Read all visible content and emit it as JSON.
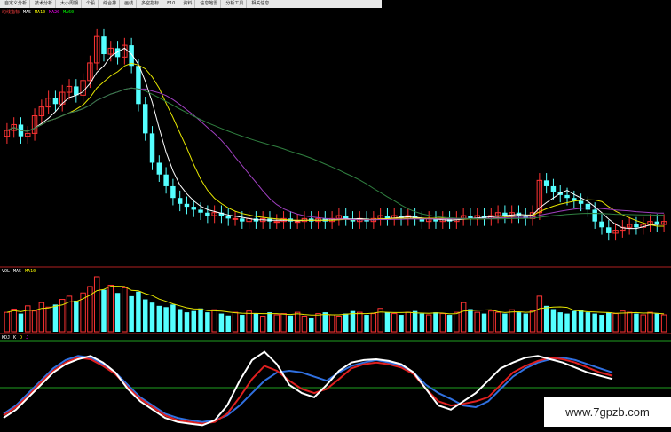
{
  "menu": {
    "items": [
      "自定义分析",
      "技术分析",
      "大小周期",
      "个股",
      "综合排",
      "画线",
      "多空指标",
      "F10",
      "资料",
      "信息地雷",
      "分析工具",
      "相关信息"
    ]
  },
  "price_panel": {
    "indicator_name": "均线指标",
    "ma_labels": [
      {
        "label": "MA5",
        "color": "#ffffff"
      },
      {
        "label": "MA10",
        "color": "#ffff00"
      },
      {
        "label": "MA20",
        "color": "#ff00ff"
      },
      {
        "label": "MA60",
        "color": "#00ff00"
      }
    ]
  },
  "volume_panel": {
    "labels": [
      {
        "label": "VOL",
        "color": "#ffffff"
      },
      {
        "label": "MA5",
        "color": "#ffffff"
      },
      {
        "label": "MA10",
        "color": "#ffff00"
      }
    ]
  },
  "kdj_panel": {
    "labels": [
      {
        "label": "KDJ",
        "color": "#ffffff"
      },
      {
        "label": "K",
        "color": "#ffffff"
      },
      {
        "label": "D",
        "color": "#ffff00"
      },
      {
        "label": "J",
        "color": "#ff00ff"
      }
    ]
  },
  "watermark": "www.7gpzb.com",
  "colors": {
    "up": "#ff3333",
    "down": "#54ffff",
    "ma_white": "#ffffff",
    "ma_yellow": "#e6e600",
    "ma_purple": "#a040c0",
    "ma_green": "#308040",
    "kdj_blue": "#3070e0",
    "kdj_red": "#e02020",
    "kdj_white": "#ffffff",
    "ref_green": "#20a020"
  },
  "chart_data": [
    {
      "type": "candlestick",
      "title": "",
      "closes": [
        12.1,
        12.3,
        11.9,
        12.0,
        12.6,
        12.9,
        13.2,
        13.0,
        13.4,
        13.6,
        13.3,
        13.8,
        14.4,
        15.3,
        14.7,
        14.9,
        14.6,
        15.0,
        14.3,
        13.0,
        12.0,
        11.0,
        10.6,
        10.2,
        9.8,
        9.6,
        9.5,
        9.4,
        9.3,
        9.2,
        9.3,
        9.2,
        9.1,
        9.1,
        9.0,
        9.1,
        9.0,
        9.1,
        9.0,
        9.0,
        9.1,
        9.0,
        9.0,
        9.1,
        9.0,
        9.1,
        9.0,
        9.1,
        9.2,
        9.1,
        9.0,
        9.1,
        9.0,
        9.1,
        9.2,
        9.1,
        9.2,
        9.1,
        9.2,
        9.1,
        9.0,
        9.1,
        9.0,
        9.1,
        9.0,
        9.1,
        9.2,
        9.1,
        9.2,
        9.1,
        9.2,
        9.3,
        9.2,
        9.3,
        9.2,
        9.1,
        9.3,
        10.4,
        10.2,
        10.0,
        9.9,
        9.8,
        9.7,
        9.6,
        9.4,
        9.0,
        8.8,
        8.6,
        8.7,
        8.8,
        8.9,
        8.8,
        8.9,
        9.0,
        8.9,
        9.0
      ],
      "ylim": [
        7.6,
        16.0
      ],
      "moving_averages": [
        "MA5",
        "MA10",
        "MA20",
        "MA60"
      ]
    },
    {
      "type": "bar",
      "title": "",
      "values": [
        30,
        35,
        28,
        40,
        32,
        45,
        38,
        42,
        50,
        55,
        48,
        60,
        70,
        85,
        65,
        72,
        60,
        68,
        55,
        62,
        50,
        45,
        40,
        38,
        42,
        35,
        30,
        32,
        36,
        30,
        34,
        28,
        25,
        30,
        26,
        32,
        28,
        24,
        30,
        26,
        28,
        25,
        30,
        24,
        22,
        28,
        30,
        26,
        24,
        28,
        32,
        30,
        26,
        28,
        36,
        30,
        28,
        26,
        30,
        32,
        28,
        26,
        30,
        28,
        26,
        30,
        45,
        35,
        30,
        28,
        32,
        30,
        28,
        34,
        30,
        28,
        32,
        55,
        40,
        35,
        30,
        28,
        32,
        34,
        30,
        28,
        26,
        30,
        28,
        32,
        30,
        28,
        26,
        30,
        28,
        26
      ]
    },
    {
      "type": "line",
      "title": "",
      "ylim": [
        0,
        100
      ],
      "series": [
        {
          "color": "#3070e0",
          "values": [
            20,
            30,
            45,
            60,
            75,
            85,
            90,
            88,
            80,
            70,
            55,
            40,
            30,
            20,
            15,
            12,
            10,
            12,
            18,
            30,
            45,
            60,
            70,
            72,
            70,
            65,
            60,
            70,
            78,
            82,
            85,
            82,
            78,
            70,
            55,
            45,
            38,
            30,
            28,
            35,
            50,
            65,
            75,
            82,
            86,
            88,
            85,
            80,
            75,
            70
          ]
        },
        {
          "color": "#e02020",
          "values": [
            18,
            28,
            42,
            58,
            72,
            82,
            88,
            86,
            78,
            68,
            52,
            38,
            28,
            18,
            12,
            10,
            8,
            10,
            20,
            40,
            62,
            78,
            72,
            60,
            50,
            45,
            50,
            62,
            75,
            80,
            82,
            80,
            76,
            68,
            50,
            35,
            30,
            32,
            35,
            40,
            55,
            70,
            78,
            84,
            88,
            86,
            82,
            76,
            70,
            66
          ]
        },
        {
          "color": "#ffffff",
          "values": [
            15,
            25,
            40,
            55,
            70,
            80,
            86,
            90,
            82,
            70,
            50,
            35,
            25,
            15,
            10,
            8,
            6,
            12,
            30,
            60,
            85,
            95,
            80,
            55,
            45,
            40,
            55,
            72,
            82,
            85,
            86,
            84,
            80,
            70,
            50,
            30,
            25,
            35,
            45,
            60,
            75,
            82,
            88,
            90,
            86,
            82,
            76,
            70,
            66,
            62
          ]
        }
      ]
    }
  ]
}
